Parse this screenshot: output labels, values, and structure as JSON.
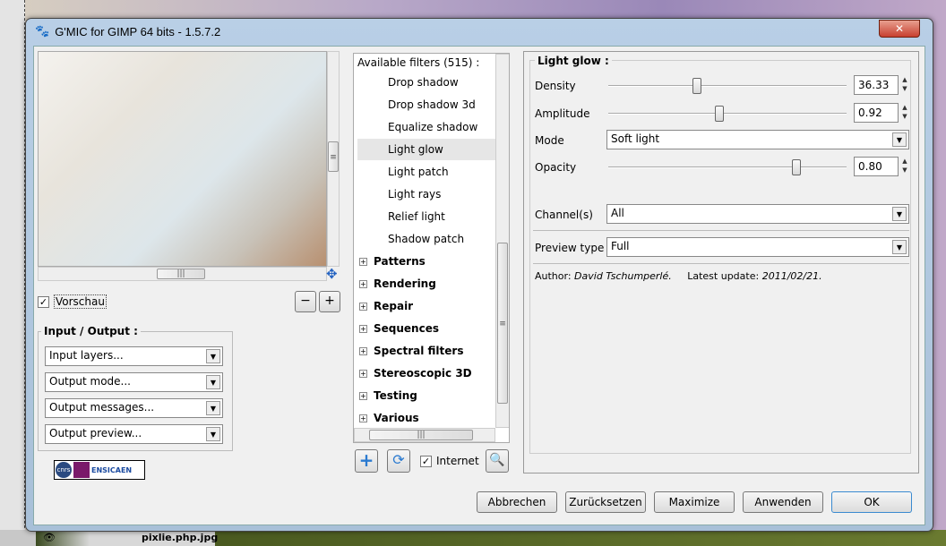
{
  "window": {
    "title": "G'MIC for GIMP 64 bits - 1.5.7.2",
    "close": "✕"
  },
  "preview": {
    "checkbox_label": "Vorschau",
    "checked": true,
    "zoom_out": "−",
    "zoom_in": "+"
  },
  "io": {
    "title": "Input / Output :",
    "combos": [
      "Input layers...",
      "Output mode...",
      "Output messages...",
      "Output preview..."
    ]
  },
  "logo": {
    "text": "ENSICAEN",
    "cnrs": "cnrs"
  },
  "filters": {
    "header": "Available filters (515) :",
    "items": [
      {
        "label": "Drop shadow",
        "type": "sub"
      },
      {
        "label": "Drop shadow 3d",
        "type": "sub"
      },
      {
        "label": "Equalize shadow",
        "type": "sub"
      },
      {
        "label": "Light glow",
        "type": "sub",
        "selected": true
      },
      {
        "label": "Light patch",
        "type": "sub"
      },
      {
        "label": "Light rays",
        "type": "sub"
      },
      {
        "label": "Relief light",
        "type": "sub"
      },
      {
        "label": "Shadow patch",
        "type": "sub"
      },
      {
        "label": "Patterns",
        "type": "cat"
      },
      {
        "label": "Rendering",
        "type": "cat"
      },
      {
        "label": "Repair",
        "type": "cat"
      },
      {
        "label": "Sequences",
        "type": "cat"
      },
      {
        "label": "Spectral filters",
        "type": "cat"
      },
      {
        "label": "Stereoscopic 3D",
        "type": "cat"
      },
      {
        "label": "Testing",
        "type": "cat"
      },
      {
        "label": "Various",
        "type": "cat"
      }
    ],
    "internet_label": "Internet",
    "internet_checked": true
  },
  "params": {
    "title": "Light glow :",
    "density": {
      "label": "Density",
      "value": "36.33",
      "fraction": 0.36
    },
    "amplitude": {
      "label": "Amplitude",
      "value": "0.92",
      "fraction": 0.46
    },
    "mode": {
      "label": "Mode",
      "value": "Soft light"
    },
    "opacity": {
      "label": "Opacity",
      "value": "0.80",
      "fraction": 0.8
    },
    "channels": {
      "label": "Channel(s)",
      "value": "All"
    },
    "preview_type": {
      "label": "Preview type",
      "value": "Full"
    },
    "author_label": "Author:",
    "author": "David Tschumperlé.",
    "update_label": "Latest update:",
    "update": "2011/02/21."
  },
  "buttons": {
    "cancel": "Abbrechen",
    "reset": "Zurücksetzen",
    "maximize": "Maximize",
    "apply": "Anwenden",
    "ok": "OK"
  },
  "background": {
    "layer_name": "pixlie.php.jpg"
  }
}
